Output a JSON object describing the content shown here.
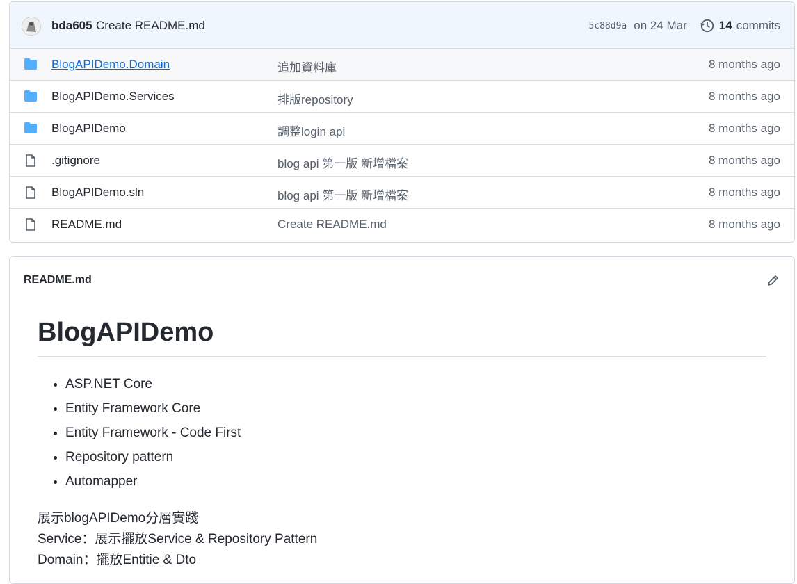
{
  "commit": {
    "author": "bda605",
    "message": "Create README.md",
    "sha": "5c88d9a",
    "date": "on 24 Mar",
    "commit_count": "14",
    "commit_label": "commits"
  },
  "files": [
    {
      "name": "BlogAPIDemo.Domain",
      "type": "folder",
      "message": "追加資料庫",
      "age": "8 months ago"
    },
    {
      "name": "BlogAPIDemo.Services",
      "type": "folder",
      "message": "排版repository",
      "age": "8 months ago"
    },
    {
      "name": "BlogAPIDemo",
      "type": "folder",
      "message": "調整login api",
      "age": "8 months ago"
    },
    {
      "name": ".gitignore",
      "type": "file",
      "message": "blog api 第一版 新增檔案",
      "age": "8 months ago"
    },
    {
      "name": "BlogAPIDemo.sln",
      "type": "file",
      "message": "blog api 第一版 新增檔案",
      "age": "8 months ago"
    },
    {
      "name": "README.md",
      "type": "file",
      "message": "Create README.md",
      "age": "8 months ago"
    }
  ],
  "readme": {
    "filename": "README.md",
    "heading": "BlogAPIDemo",
    "bullets": [
      "ASP.NET Core",
      "Entity Framework Core",
      "Entity Framework - Code First",
      "Repository pattern",
      "Automapper"
    ],
    "lines": [
      "展示blogAPIDemo分層實踐",
      "Service：展示擺放Service & Repository Pattern",
      "Domain：擺放Entitie & Dto"
    ]
  },
  "colors": {
    "folder": "#54aeff",
    "link": "#0969da",
    "muted": "#57606a"
  }
}
